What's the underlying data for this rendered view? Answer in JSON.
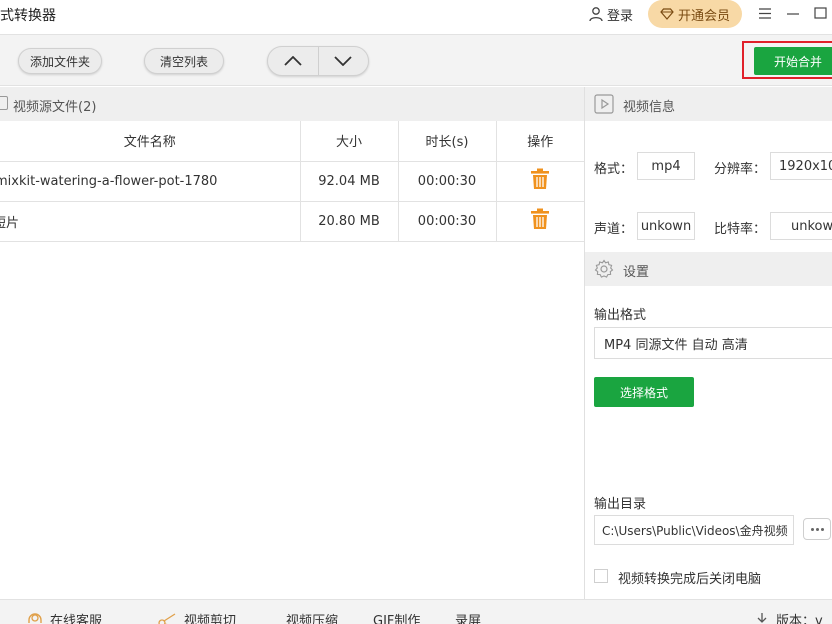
{
  "window": {
    "title": "式转换器",
    "login_label": "登录",
    "vip_label": "开通会员"
  },
  "toolbar": {
    "add_folder": "添加文件夹",
    "clear_list": "清空列表",
    "start_merge": "开始合并"
  },
  "source": {
    "header": "视频源文件(2)",
    "columns": [
      "文件名称",
      "大小",
      "时长(s)",
      "操作"
    ],
    "rows": [
      {
        "name": "mixkit-watering-a-flower-pot-1780",
        "size": "92.04 MB",
        "duration": "00:00:30"
      },
      {
        "name": "短片",
        "size": "20.80 MB",
        "duration": "00:00:30"
      }
    ]
  },
  "video_info": {
    "header": "视频信息",
    "format_label": "格式：",
    "format_value": "mp4",
    "resolution_label": "分辨率：",
    "resolution_value": "1920x10",
    "channel_label": "声道：",
    "channel_value": "unkown",
    "bitrate_label": "比特率：",
    "bitrate_value": "unkow"
  },
  "settings": {
    "header": "设置",
    "output_format_label": "输出格式",
    "output_format_value": "MP4 同源文件 自动 高清",
    "select_format_button": "选择格式",
    "output_dir_label": "输出目录",
    "output_dir_value": "C:\\Users\\Public\\Videos\\金舟视频",
    "shutdown_label": "视频转换完成后关闭电脑"
  },
  "bottom": {
    "service": "在线客服",
    "clip": "视频剪切",
    "compress": "视频压缩",
    "gif": "GIF制作",
    "record": "录屏",
    "version": "版本：v"
  },
  "colors": {
    "green": "#1aa540",
    "highlight": "#e0202a",
    "trash": "#f0921e",
    "vip_bg": "#f8d9a6"
  }
}
